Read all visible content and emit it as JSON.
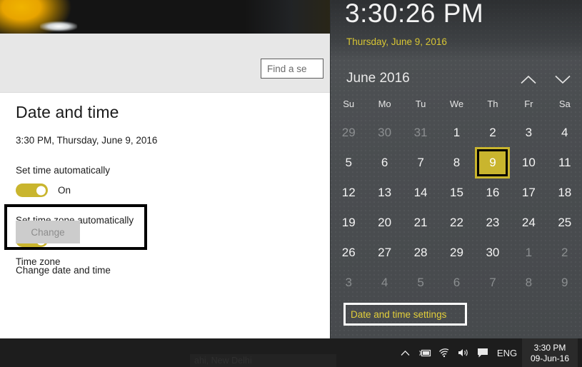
{
  "desktop": {
    "wallpaper_alt": "dark desktop wallpaper with amber glass"
  },
  "settings_window": {
    "search": {
      "placeholder": "Find a setting",
      "value": "Find a se"
    },
    "page_title": "Date and time",
    "current_datetime": "3:30 PM, Thursday, June 9, 2016",
    "set_time_automatically": {
      "label": "Set time automatically",
      "state": "On"
    },
    "set_timezone_automatically": {
      "label": "Set time zone automatically",
      "state": "On"
    },
    "change_date_time": {
      "label": "Change date and time",
      "button": "Change"
    },
    "time_zone_label": "Time zone"
  },
  "flyout": {
    "time": "3:30:26 PM",
    "date": "Thursday, June 9, 2016",
    "calendar": {
      "month_year": "June 2016",
      "prev_icon": "chevron-up-icon",
      "next_icon": "chevron-down-icon",
      "weekdays": [
        "Su",
        "Mo",
        "Tu",
        "We",
        "Th",
        "Fr",
        "Sa"
      ],
      "days": [
        {
          "n": "29",
          "muted": true
        },
        {
          "n": "30",
          "muted": true
        },
        {
          "n": "31",
          "muted": true
        },
        {
          "n": "1"
        },
        {
          "n": "2"
        },
        {
          "n": "3"
        },
        {
          "n": "4"
        },
        {
          "n": "5"
        },
        {
          "n": "6"
        },
        {
          "n": "7"
        },
        {
          "n": "8"
        },
        {
          "n": "9",
          "today": true
        },
        {
          "n": "10"
        },
        {
          "n": "11"
        },
        {
          "n": "12"
        },
        {
          "n": "13"
        },
        {
          "n": "14"
        },
        {
          "n": "15"
        },
        {
          "n": "16"
        },
        {
          "n": "17"
        },
        {
          "n": "18"
        },
        {
          "n": "19"
        },
        {
          "n": "20"
        },
        {
          "n": "21"
        },
        {
          "n": "22"
        },
        {
          "n": "23"
        },
        {
          "n": "24"
        },
        {
          "n": "25"
        },
        {
          "n": "26"
        },
        {
          "n": "27"
        },
        {
          "n": "28"
        },
        {
          "n": "29"
        },
        {
          "n": "30"
        },
        {
          "n": "1",
          "muted": true
        },
        {
          "n": "2",
          "muted": true
        },
        {
          "n": "3",
          "muted": true
        },
        {
          "n": "4",
          "muted": true
        },
        {
          "n": "5",
          "muted": true
        },
        {
          "n": "6",
          "muted": true
        },
        {
          "n": "7",
          "muted": true
        },
        {
          "n": "8",
          "muted": true
        },
        {
          "n": "9",
          "muted": true
        }
      ]
    },
    "settings_link": "Date and time settings"
  },
  "taskbar": {
    "timezone_dropdown": "ahi, New Delhi",
    "tray": {
      "show_hidden_icon": "chevron-up-icon",
      "battery_icon": "battery-icon",
      "network_icon": "wifi-icon",
      "volume_icon": "speaker-icon",
      "action_center_icon": "action-center-icon",
      "language": "ENG",
      "clock_time": "3:30 PM",
      "clock_date": "09-Jun-16"
    }
  },
  "colors": {
    "accent_gold": "#c9b52e",
    "link_yellow": "#e3cf3a",
    "flyout_bg": "#4a4d50",
    "taskbar_bg": "#1d1d1d",
    "annotation_black": "#000000",
    "annotation_white": "#ffffff"
  }
}
